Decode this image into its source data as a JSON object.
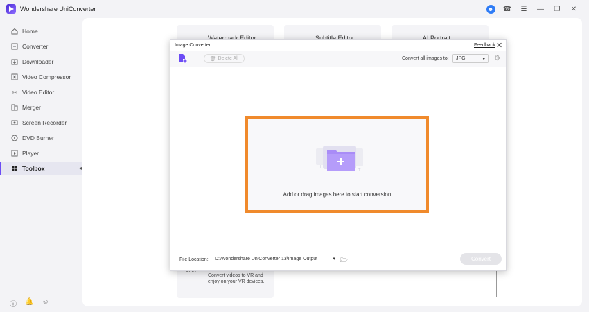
{
  "app": {
    "title": "Wondershare UniConverter"
  },
  "sidebar": {
    "items": [
      {
        "label": "Home",
        "icon": "home-icon"
      },
      {
        "label": "Converter",
        "icon": "converter-icon"
      },
      {
        "label": "Downloader",
        "icon": "downloader-icon"
      },
      {
        "label": "Video Compressor",
        "icon": "compressor-icon"
      },
      {
        "label": "Video Editor",
        "icon": "scissors-icon"
      },
      {
        "label": "Merger",
        "icon": "merger-icon"
      },
      {
        "label": "Screen Recorder",
        "icon": "record-icon"
      },
      {
        "label": "DVD Burner",
        "icon": "disc-icon"
      },
      {
        "label": "Player",
        "icon": "play-icon"
      },
      {
        "label": "Toolbox",
        "icon": "grid-icon",
        "active": true
      }
    ]
  },
  "background": {
    "cards": [
      "Watermark Editor",
      "Subtitle Editor",
      "AI Portrait"
    ],
    "vr_text_1": "Convert videos to VR and",
    "vr_text_2": "enjoy on your VR devices."
  },
  "dialog": {
    "title": "Image Converter",
    "feedback": "Feedback",
    "delete_all": "Delete All",
    "convert_all_label": "Convert all images to:",
    "format_value": "JPG",
    "drop_text": "Add or drag images here to start conversion",
    "file_location_label": "File Location:",
    "file_location_value": "D:\\Wondershare UniConverter 13\\Image Output",
    "convert_button": "Convert"
  },
  "colors": {
    "accent": "#6c4cf5",
    "highlight": "#f08a2c"
  }
}
